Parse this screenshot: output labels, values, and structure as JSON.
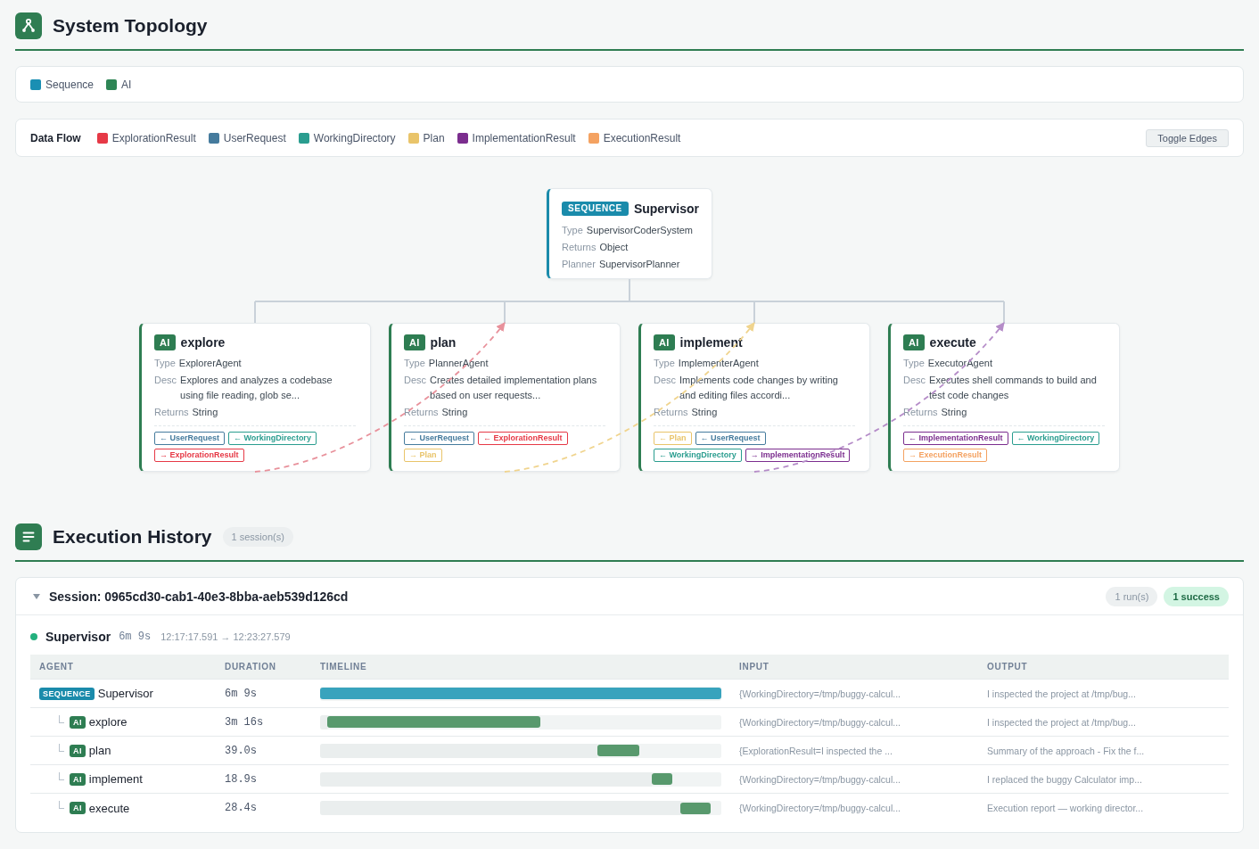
{
  "topology": {
    "title": "System Topology",
    "legend": [
      {
        "label": "Sequence",
        "color": "#1a8fb3"
      },
      {
        "label": "AI",
        "color": "#2e8555"
      }
    ],
    "data_flow": {
      "title": "Data Flow",
      "types": [
        {
          "label": "ExplorationResult",
          "color": "#e63946"
        },
        {
          "label": "UserRequest",
          "color": "#457b9d"
        },
        {
          "label": "WorkingDirectory",
          "color": "#2a9d8f"
        },
        {
          "label": "Plan",
          "color": "#e9c46a"
        },
        {
          "label": "ImplementationResult",
          "color": "#7b2d8e"
        },
        {
          "label": "ExecutionResult",
          "color": "#f4a261"
        }
      ],
      "toggle_button": "Toggle Edges"
    },
    "root": {
      "kind": "sequence",
      "badge": "SEQUENCE",
      "name": "Supervisor",
      "fields": [
        {
          "label": "Type",
          "value": "SupervisorCoderSystem"
        },
        {
          "label": "Returns",
          "value": "Object"
        },
        {
          "label": "Planner",
          "value": "SupervisorPlanner"
        }
      ],
      "children": [
        {
          "kind": "ai",
          "badge": "AI",
          "name": "explore",
          "fields": [
            {
              "label": "Type",
              "value": "ExplorerAgent"
            },
            {
              "label": "Desc",
              "value": "Explores and analyzes a codebase using file reading, glob se..."
            },
            {
              "label": "Returns",
              "value": "String"
            }
          ],
          "ports": [
            {
              "label": "← UserRequest",
              "color": "#457b9d"
            },
            {
              "label": "← WorkingDirectory",
              "color": "#2a9d8f"
            },
            {
              "label": "→ ExplorationResult",
              "color": "#e63946"
            }
          ]
        },
        {
          "kind": "ai",
          "badge": "AI",
          "name": "plan",
          "fields": [
            {
              "label": "Type",
              "value": "PlannerAgent"
            },
            {
              "label": "Desc",
              "value": "Creates detailed implementation plans based on user requests..."
            },
            {
              "label": "Returns",
              "value": "String"
            }
          ],
          "ports": [
            {
              "label": "← UserRequest",
              "color": "#457b9d"
            },
            {
              "label": "← ExplorationResult",
              "color": "#e63946"
            },
            {
              "label": "→ Plan",
              "color": "#e9c46a"
            }
          ]
        },
        {
          "kind": "ai",
          "badge": "AI",
          "name": "implement",
          "fields": [
            {
              "label": "Type",
              "value": "ImplementerAgent"
            },
            {
              "label": "Desc",
              "value": "Implements code changes by writing and editing files accordi..."
            },
            {
              "label": "Returns",
              "value": "String"
            }
          ],
          "ports": [
            {
              "label": "← Plan",
              "color": "#e9c46a"
            },
            {
              "label": "← UserRequest",
              "color": "#457b9d"
            },
            {
              "label": "← WorkingDirectory",
              "color": "#2a9d8f"
            },
            {
              "label": "→ ImplementationResult",
              "color": "#7b2d8e"
            }
          ]
        },
        {
          "kind": "ai",
          "badge": "AI",
          "name": "execute",
          "fields": [
            {
              "label": "Type",
              "value": "ExecutorAgent"
            },
            {
              "label": "Desc",
              "value": "Executes shell commands to build and test code changes"
            },
            {
              "label": "Returns",
              "value": "String"
            }
          ],
          "ports": [
            {
              "label": "← ImplementationResult",
              "color": "#7b2d8e"
            },
            {
              "label": "← WorkingDirectory",
              "color": "#2a9d8f"
            },
            {
              "label": "→ ExecutionResult",
              "color": "#f4a261"
            }
          ]
        }
      ]
    },
    "edges": [
      {
        "color": "#e8919b"
      },
      {
        "color": "#f0d48e"
      },
      {
        "color": "#b58cc8"
      }
    ]
  },
  "history": {
    "title": "Execution History",
    "count": "1 session(s)",
    "sessions": [
      {
        "title": "Session: 0965cd30-cab1-40e3-8bba-aeb539d126cd",
        "expanded": true,
        "runs_count": "1 run(s)",
        "status_summary": "1 success",
        "runs": [
          {
            "name": "Supervisor",
            "color": "#22b07d",
            "duration": "6m 9s",
            "time_range": "12:17:17.591 → 12:23:27.579",
            "table": {
              "columns": [
                "AGENT",
                "DURATION",
                "TIMELINE",
                "INPUT",
                "OUTPUT"
              ],
              "rows": [
                {
                  "kind": "sequence",
                  "badge": "SEQUENCE",
                  "agent": "Supervisor",
                  "duration": "6m 9s",
                  "timeline": {
                    "active": {
                      "level": 1
                    }
                  },
                  "input": "{WorkingDirectory=/tmp/buggy-calcul...",
                  "output": "I inspected the project at /tmp/bug...",
                  "children": [
                    {
                      "kind": "ai",
                      "badge": "AI",
                      "agent": "explore",
                      "duration": "3m 16s",
                      "timeline": {
                        "idle": {
                          "level": 0.018
                        },
                        "active": {
                          "level": 0.541
                        }
                      },
                      "input": "{WorkingDirectory=/tmp/buggy-calcul...",
                      "output": "I inspected the project at /tmp/bug..."
                    },
                    {
                      "kind": "ai",
                      "badge": "AI",
                      "agent": "plan",
                      "duration": "39.0s",
                      "timeline": {
                        "idle": {
                          "level": 0.691
                        },
                        "active": {
                          "level": 0.34
                        }
                      },
                      "input": "{ExplorationResult=I inspected the ...",
                      "output": "Summary of the approach - Fix the f..."
                    },
                    {
                      "kind": "ai",
                      "badge": "AI",
                      "agent": "implement",
                      "duration": "18.9s",
                      "timeline": {
                        "idle": {
                          "level": 0.827
                        },
                        "active": {
                          "level": 0.295
                        }
                      },
                      "input": "{WorkingDirectory=/tmp/buggy-calcul...",
                      "output": "I replaced the buggy Calculator imp..."
                    },
                    {
                      "kind": "ai",
                      "badge": "AI",
                      "agent": "execute",
                      "duration": "28.4s",
                      "timeline": {
                        "idle": {
                          "level": 0.898
                        },
                        "active": {
                          "level": 0.735
                        }
                      },
                      "input": "{WorkingDirectory=/tmp/buggy-calcul...",
                      "output": "Execution report — working director..."
                    }
                  ]
                }
              ]
            }
          }
        ]
      }
    ]
  }
}
